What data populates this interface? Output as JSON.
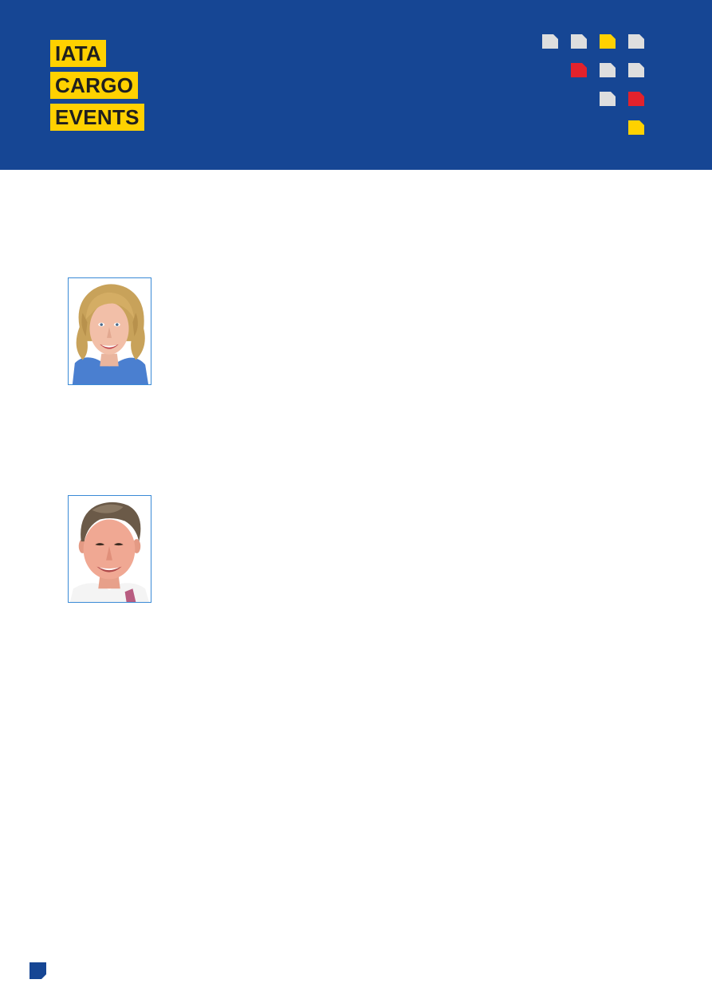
{
  "logo": {
    "line1": "IATA",
    "line2": "CARGO",
    "line3": "EVENTS"
  },
  "colors": {
    "header_blue": "#164694",
    "logo_yellow": "#ffd100",
    "accent_red": "#e2222c",
    "tile_grey": "#dedede",
    "photo_border": "#3a8ad6"
  },
  "decorative_tiles": [
    "grey",
    "grey",
    "yellow",
    "grey",
    "red",
    "grey",
    "grey",
    "grey",
    "red",
    "yellow"
  ],
  "speakers": [
    {
      "photo": "speaker-photo-woman"
    },
    {
      "photo": "speaker-photo-man"
    }
  ]
}
